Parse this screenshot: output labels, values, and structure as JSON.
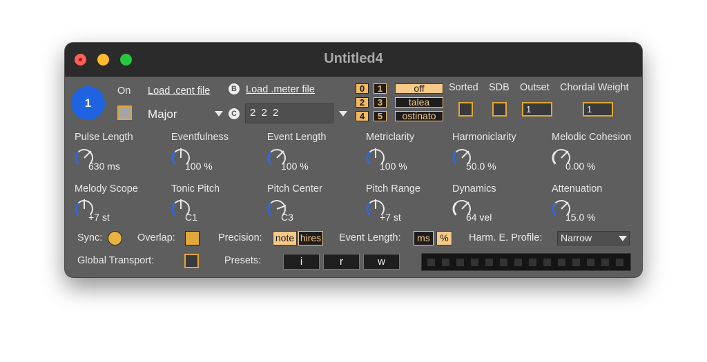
{
  "window": {
    "title": "Untitled4"
  },
  "device": {
    "number": "1",
    "on_label": "On",
    "load_cent_label": "Load .cent file",
    "load_meter_label": "Load .meter file",
    "b_label": "B",
    "c_label": "C",
    "scale_value": "Major",
    "meter_value": "2 2 2",
    "number_buttons": [
      "0",
      "1",
      "2",
      "3",
      "4",
      "5"
    ],
    "modes": [
      "off",
      "talea",
      "ostinato"
    ],
    "headers": {
      "sorted": "Sorted",
      "sdb": "SDB",
      "outset": "Outset",
      "chordal_weight": "Chordal Weight"
    },
    "outset_value": "1",
    "chordal_weight_value": "1"
  },
  "dials_row1": [
    {
      "label": "Pulse Length",
      "value": "630 ms"
    },
    {
      "label": "Eventfulness",
      "value": "100 %"
    },
    {
      "label": "Event Length",
      "value": "100 %"
    },
    {
      "label": "Metriclarity",
      "value": "100 %"
    },
    {
      "label": "Harmoniclarity",
      "value": "50.0 %"
    },
    {
      "label": "Melodic Cohesion",
      "value": "0.00 %"
    }
  ],
  "dials_row2": [
    {
      "label": "Melody Scope",
      "value": "+7 st"
    },
    {
      "label": "Tonic Pitch",
      "value": "C1"
    },
    {
      "label": "Pitch Center",
      "value": "C3"
    },
    {
      "label": "Pitch Range",
      "value": "+7 st"
    },
    {
      "label": "Dynamics",
      "value": "64 vel"
    },
    {
      "label": "Attenuation",
      "value": "15.0 %"
    }
  ],
  "bottom": {
    "sync_label": "Sync:",
    "overlap_label": "Overlap:",
    "precision_label": "Precision:",
    "precision_options": [
      "note",
      "hires"
    ],
    "event_length_label": "Event Length:",
    "event_length_options": [
      "ms",
      "%"
    ],
    "profile_label": "Harm. E. Profile:",
    "profile_value": "Narrow",
    "global_transport_label": "Global Transport:",
    "presets_label": "Presets:",
    "preset_buttons": [
      "i",
      "r",
      "w"
    ]
  },
  "colors": {
    "accent_orange": "#f2b961",
    "dial_blue": "#2a6ae0",
    "panel": "#5e5e5e"
  },
  "icons": [
    "close-icon",
    "minimize-icon",
    "maximize-icon",
    "dropdown-arrow-icon"
  ]
}
